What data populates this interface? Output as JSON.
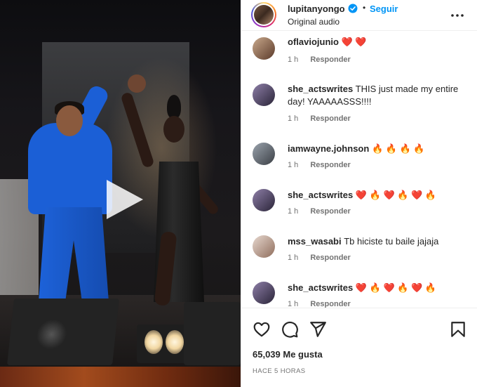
{
  "post": {
    "username": "lupitanyongo",
    "follow_label": "Seguir",
    "audio_label": "Original audio",
    "verified_icon": "verified-badge-icon",
    "more_icon": "more-options-icon"
  },
  "colors": {
    "link_blue": "#0095f6",
    "text": "#262626",
    "muted": "#737373",
    "heart": "#ed4956",
    "fire": "#f7792a"
  },
  "comments": [
    {
      "user": "oflaviojunio",
      "text": "",
      "emoji": "❤️ ❤️",
      "time": "1 h",
      "reply": "Responder"
    },
    {
      "user": "she_actswrites",
      "text": "THIS just made my entire day! YAAAAASSS!!!!",
      "emoji": "",
      "time": "1 h",
      "reply": "Responder"
    },
    {
      "user": "iamwayne.johnson",
      "text": "",
      "emoji": "🔥 🔥 🔥 🔥",
      "time": "1 h",
      "reply": "Responder"
    },
    {
      "user": "she_actswrites",
      "text": "",
      "emoji": "❤️ 🔥 ❤️ 🔥 ❤️ 🔥",
      "time": "1 h",
      "reply": "Responder"
    },
    {
      "user": "mss_wasabi",
      "text": "Tb hiciste tu baile jajaja",
      "emoji": "",
      "time": "1 h",
      "reply": "Responder"
    },
    {
      "user": "she_actswrites",
      "text": "",
      "emoji": "❤️ 🔥 ❤️ 🔥 ❤️ 🔥",
      "time": "1 h",
      "reply": "Responder"
    }
  ],
  "actions": {
    "like_icon": "heart-icon",
    "comment_icon": "comment-bubble-icon",
    "share_icon": "send-paper-plane-icon",
    "save_icon": "bookmark-icon",
    "likes_label": "65,039 Me gusta",
    "timestamp": "HACE 5 HORAS"
  },
  "video": {
    "play_icon": "play-icon"
  }
}
